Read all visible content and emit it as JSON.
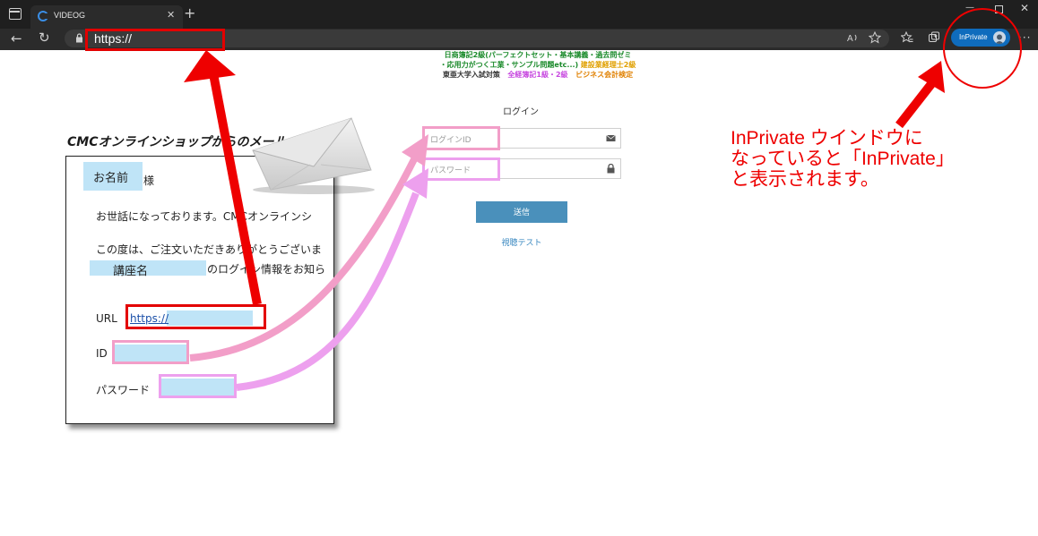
{
  "browser": {
    "tab_title": "VIDEOG",
    "tab_close": "✕",
    "new_tab": "+",
    "window_min": "—",
    "window_close": "✕",
    "nav_back": "←",
    "nav_reload": "↻",
    "url": "https://",
    "inprivate_label": "InPrivate",
    "more": "···",
    "accent_color": "#0f6cbd"
  },
  "banner": {
    "line1": "日商簿記2級(パーフェクトセット・基本講義・過去問ゼミ",
    "line2_green": "・応用力がつく工業・サンプル問題etc...)",
    "line2_orange": "建設業経理士2級",
    "line3_a": "東亜大学入試対策",
    "line3_b": "全経簿記1級・2級",
    "line3_c": "ビジネス会計検定"
  },
  "login": {
    "title": "ログイン",
    "id_placeholder": "ログインID",
    "password_placeholder": "パスワード",
    "submit_label": "送信",
    "test_link": "視聴テスト",
    "button_color": "#4a90bb"
  },
  "mail": {
    "heading": "CMCオンラインショップからのメール",
    "name_field": "お名前",
    "honorific": "様",
    "line1": "お世話になっております。CMCオンラインシ",
    "line2": "この度は、ご注文いただきありがとうございま",
    "course_field": "講座名",
    "line3_suffix": "のログイン情報をお知ら",
    "url_label": "URL",
    "url_link": "https://",
    "id_label": "ID",
    "password_label": "パスワード"
  },
  "callout": {
    "line1": "InPrivate ウインドウに",
    "line2": "なっていると「InPrivate」",
    "line3": "と表示されます。"
  }
}
